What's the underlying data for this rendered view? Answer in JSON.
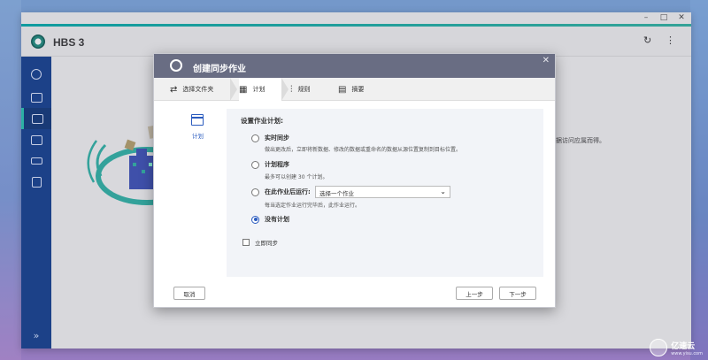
{
  "window": {
    "controls": [
      "–",
      "□",
      "✕"
    ]
  },
  "app": {
    "title": "HBS 3",
    "background_text": "据访问应属而得。"
  },
  "sidebar": {
    "items": [
      "dashboard-icon",
      "sync-icon",
      "sync-job-icon",
      "storage-icon",
      "services-icon",
      "log-icon"
    ],
    "expand": "»"
  },
  "dialog": {
    "title": "创建同步作业",
    "close": "✕",
    "steps": [
      {
        "label": "选择文件夹"
      },
      {
        "label": "计划"
      },
      {
        "label": "规则"
      },
      {
        "label": "摘要"
      }
    ],
    "left_label": "计划",
    "section_title": "设置作业计划:",
    "options": {
      "realtime_label": "实时同步",
      "realtime_desc": "做出更改后，立即将新数据、修改的数据或重命名的数据从源位置复制到目标位置。",
      "schedule_label": "计划程序",
      "schedule_desc": "最多可以创建 30 个计划。",
      "after_label": "在此作业后运行:",
      "after_desc": "每当选定作业运行完毕后，此作业运行。",
      "none_label": "没有计划"
    },
    "select_placeholder": "选择一个作业",
    "sync_now_label": "立即同步",
    "buttons": {
      "cancel": "取消",
      "prev": "上一步",
      "next": "下一步"
    }
  },
  "watermark": {
    "brand": "亿速云",
    "sub": "www.yisu.com"
  },
  "colors": {
    "sidebar": "#0f3c8e",
    "accent": "#2a5bbf",
    "dialog_title": "#696d83",
    "teal": "#23c4b0"
  }
}
